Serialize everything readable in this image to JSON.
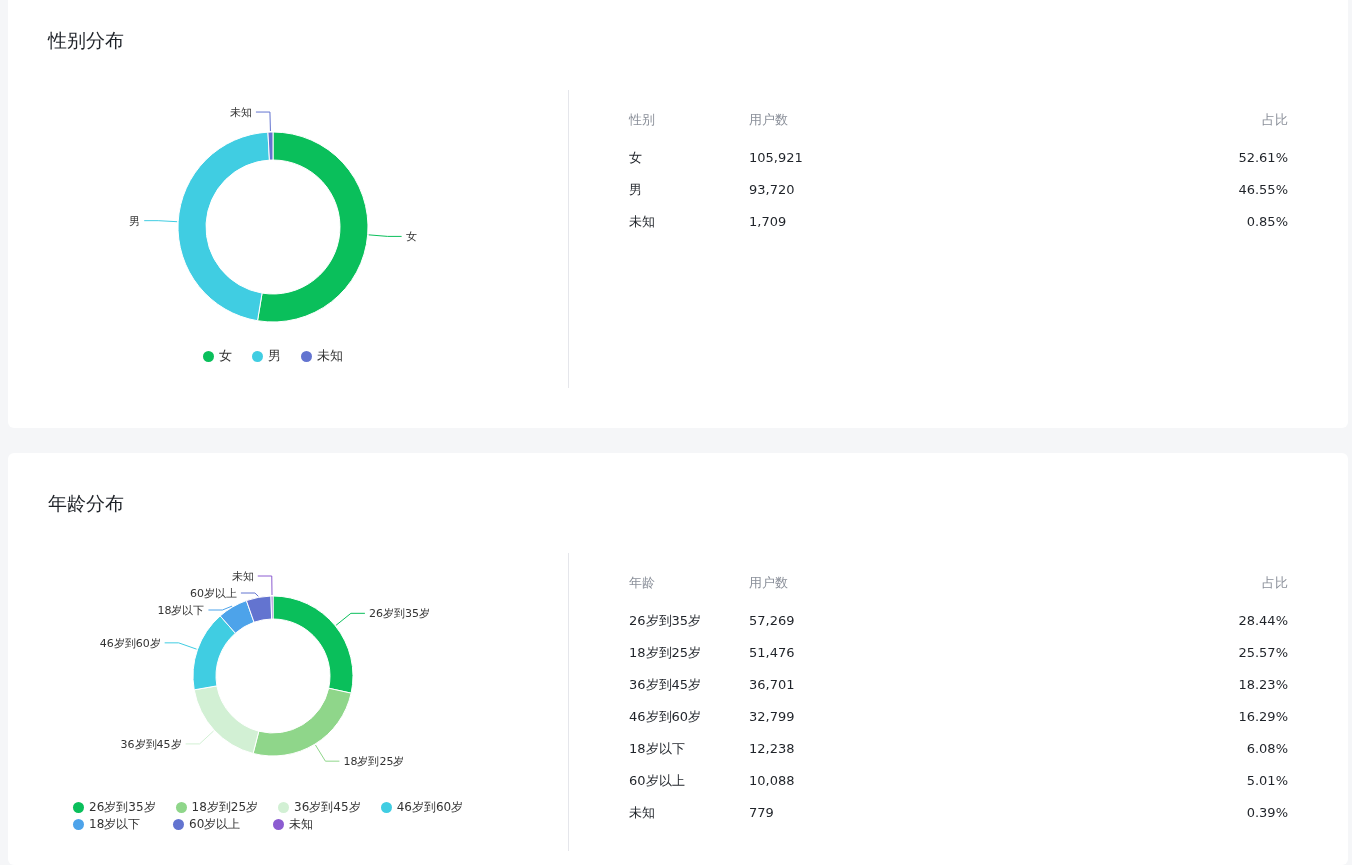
{
  "sections": [
    {
      "title": "性别分布",
      "chart_data": {
        "type": "donut",
        "categories": [
          "女",
          "男",
          "未知"
        ],
        "values": [
          52.61,
          46.55,
          0.85
        ]
      },
      "legend": [
        {
          "label": "女",
          "color": "#0abf5b"
        },
        {
          "label": "男",
          "color": "#40cde2"
        },
        {
          "label": "未知",
          "color": "#6374d0"
        }
      ],
      "table": {
        "columns": [
          "性别",
          "用户数",
          "占比"
        ],
        "rows": [
          [
            "女",
            "105,921",
            "52.61%"
          ],
          [
            "男",
            "93,720",
            "46.55%"
          ],
          [
            "未知",
            "1,709",
            "0.85%"
          ]
        ]
      }
    },
    {
      "title": "年龄分布",
      "chart_data": {
        "type": "donut",
        "categories": [
          "26岁到35岁",
          "18岁到25岁",
          "36岁到45岁",
          "46岁到60岁",
          "18岁以下",
          "60岁以上",
          "未知"
        ],
        "values": [
          28.44,
          25.57,
          18.23,
          16.29,
          6.08,
          5.01,
          0.39
        ]
      },
      "legend": [
        {
          "label": "26岁到35岁",
          "color": "#0abf5b"
        },
        {
          "label": "18岁到25岁",
          "color": "#8fd68a"
        },
        {
          "label": "36岁到45岁",
          "color": "#d2f0d4"
        },
        {
          "label": "46岁到60岁",
          "color": "#40cde2"
        },
        {
          "label": "18岁以下",
          "color": "#4da3ea"
        },
        {
          "label": "60岁以上",
          "color": "#6374d0"
        },
        {
          "label": "未知",
          "color": "#8c5cd1"
        }
      ],
      "table": {
        "columns": [
          "年龄",
          "用户数",
          "占比"
        ],
        "rows": [
          [
            "26岁到35岁",
            "57,269",
            "28.44%"
          ],
          [
            "18岁到25岁",
            "51,476",
            "25.57%"
          ],
          [
            "36岁到45岁",
            "36,701",
            "18.23%"
          ],
          [
            "46岁到60岁",
            "32,799",
            "16.29%"
          ],
          [
            "18岁以下",
            "12,238",
            "6.08%"
          ],
          [
            "60岁以上",
            "10,088",
            "5.01%"
          ],
          [
            "未知",
            "779",
            "0.39%"
          ]
        ]
      }
    }
  ]
}
